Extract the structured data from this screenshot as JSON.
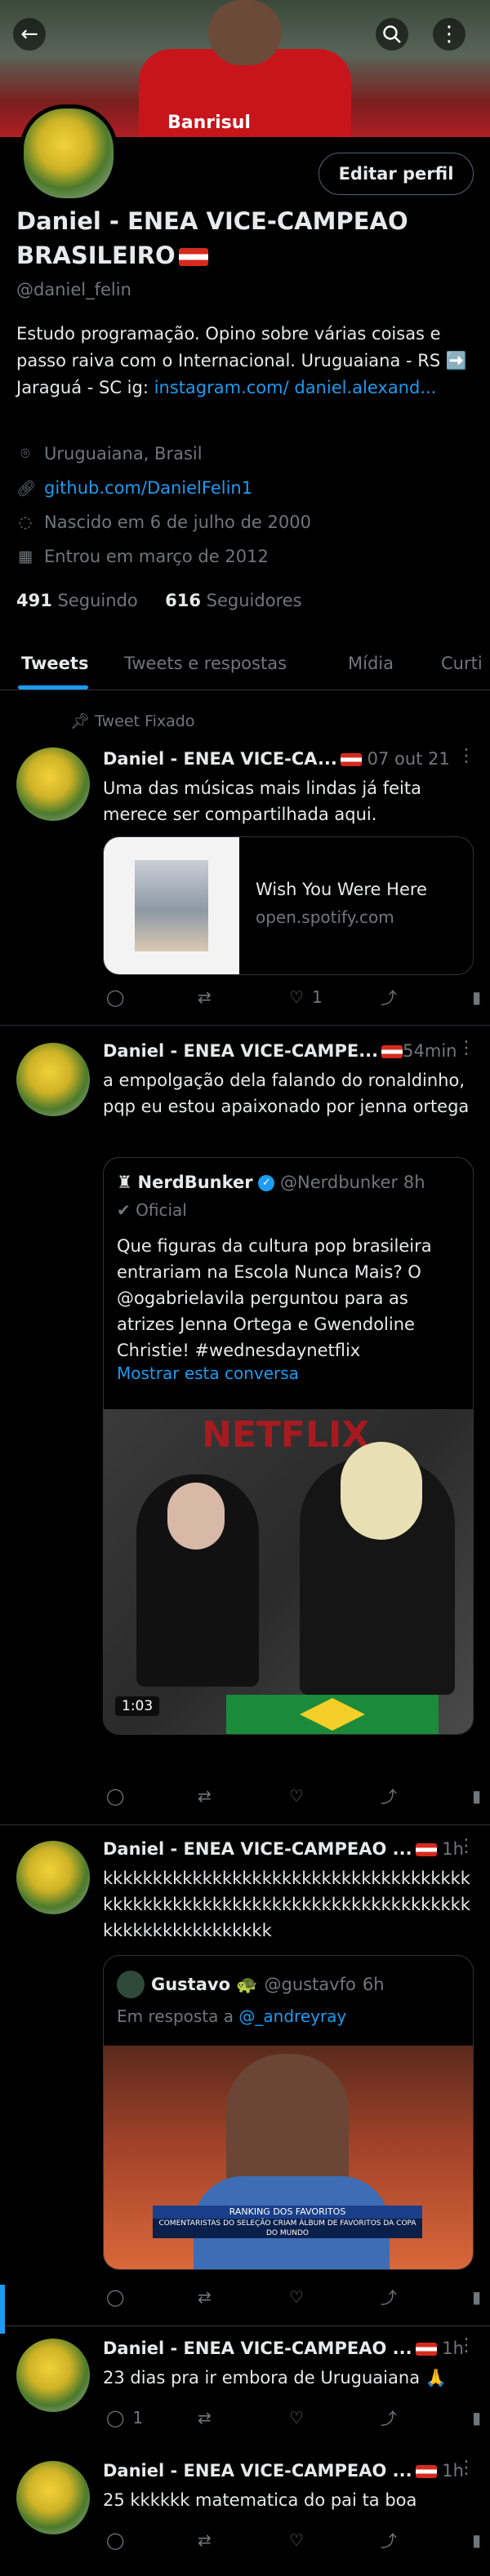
{
  "header": {
    "sponsor": "Banrisul"
  },
  "profile": {
    "edit_label": "Editar perfil",
    "name": "Daniel - ENEA VICE-CAMPEAO BRASILEIRO",
    "handle": "@daniel_felin",
    "bio_text": "Estudo programação. Opino sobre várias coisas e passo raiva com o Internacional. Uruguaiana - RS ➡️ Jaraguá - SC  ig:",
    "bio_link": "instagram.com/ daniel.alexand...",
    "location": "Uruguaiana, Brasil",
    "website": "github.com/DanielFelin1",
    "birthday": "Nascido em 6 de julho de 2000",
    "joined": "Entrou em março de 2012",
    "following_count": "491",
    "following_label": "Seguindo",
    "followers_count": "616",
    "followers_label": "Seguidores"
  },
  "tabs": [
    "Tweets",
    "Tweets e respostas",
    "Mídia",
    "Curti"
  ],
  "pinned_label": "Tweet Fixado",
  "tweets": [
    {
      "name": "Daniel - ENEA VICE-CA...",
      "time": "07 out 21",
      "text": "Uma das músicas mais lindas já feita merece ser compartilhada aqui.",
      "card_title": "Wish You Were Here",
      "card_domain": "open.spotify.com",
      "likes": "1"
    },
    {
      "name": "Daniel - ENEA VICE-CAMPE...",
      "time": "54min",
      "text": "a empolgação dela falando do ronaldinho, pqp eu estou apaixonado por jenna ortega",
      "quote_name": "NerdBunker",
      "quote_handle": "@Nerdbunker",
      "quote_time": "8h",
      "quote_official": "Oficial",
      "quote_text": "Que figuras da cultura pop brasileira entrariam na Escola Nunca Mais? O @ogabrielavila perguntou para as atrizes Jenna Ortega e Gwendoline Christie! #wednesdaynetflix",
      "quote_more": "Mostrar esta conversa",
      "video_brand": "NETFLIX",
      "video_duration": "1:03"
    },
    {
      "name": "Daniel - ENEA VICE-CAMPEAO ...",
      "time": "1h",
      "text": "kkkkkkkkkkkkkkkkkkkkkkkkkkkkkkkkkkkkkkkkkkkkkkkkkkkkkkkkkkkkkkkkkkkkkkkkkkkkkkkkkkkkkkkkkkk",
      "quote_name": "Gustavo 🐢",
      "quote_handle": "@gustavfo",
      "quote_time": "6h",
      "reply_prefix": "Em resposta a",
      "reply_to": "@_andreyray",
      "caption_top": "RANKING DOS FAVORITOS",
      "caption_bottom": "COMENTARISTAS DO SELEÇÃO CRIAM ÁLBUM DE FAVORITOS DA COPA DO MUNDO"
    },
    {
      "name": "Daniel - ENEA VICE-CAMPEAO ...",
      "time": "1h",
      "text": "23 dias pra ir embora de Uruguaiana 🙏",
      "replies": "1"
    },
    {
      "name": "Daniel - ENEA VICE-CAMPEAO ...",
      "time": "1h",
      "text": "25 kkkkkk matematica do pai ta boa"
    }
  ],
  "icons": {
    "back": "←",
    "search": "⌕",
    "more": "⋮",
    "reply": "◯",
    "retweet": "⇄",
    "like": "♡",
    "share": "⤴",
    "stats": "▮"
  },
  "colors": {
    "accent": "#1d9bf0",
    "background": "#000000",
    "muted": "#71767b",
    "text": "#e7e9ea"
  }
}
